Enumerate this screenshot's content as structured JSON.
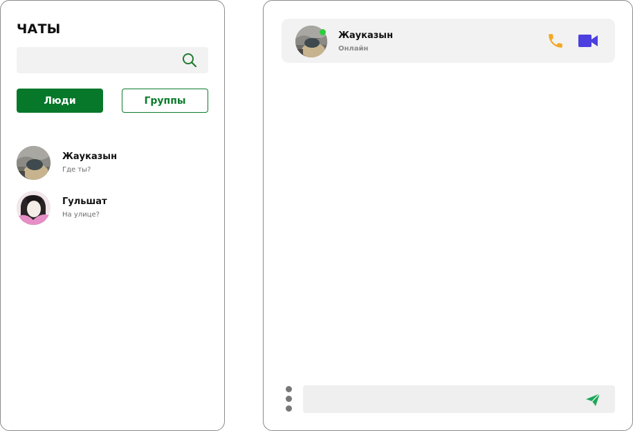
{
  "sidebar": {
    "title": "ЧАТЫ",
    "search": {
      "placeholder": "",
      "value": "",
      "icon": "search-icon"
    },
    "filters": {
      "people_label": "Люди",
      "groups_label": "Группы",
      "active": "people"
    },
    "contacts": [
      {
        "name": "Жауказын",
        "preview": "Где ты?",
        "avatar": "avatar-photo"
      },
      {
        "name": "Гульшат",
        "preview": "На улице?",
        "avatar": "avatar-photo"
      }
    ]
  },
  "chat": {
    "header": {
      "name": "Жауказын",
      "status": "Онлайн",
      "online": true,
      "call_icon": "phone-icon",
      "video_icon": "video-camera-icon"
    },
    "composer": {
      "placeholder": "",
      "value": "",
      "menu_icon": "more-vertical-icon",
      "send_icon": "send-icon"
    }
  },
  "colors": {
    "primary_green": "#07782a",
    "online_green": "#2ecc40",
    "call_orange": "#f5a623",
    "video_purple": "#4b3fe0",
    "send_green": "#1fa85a",
    "input_bg": "#f2f2f2"
  }
}
